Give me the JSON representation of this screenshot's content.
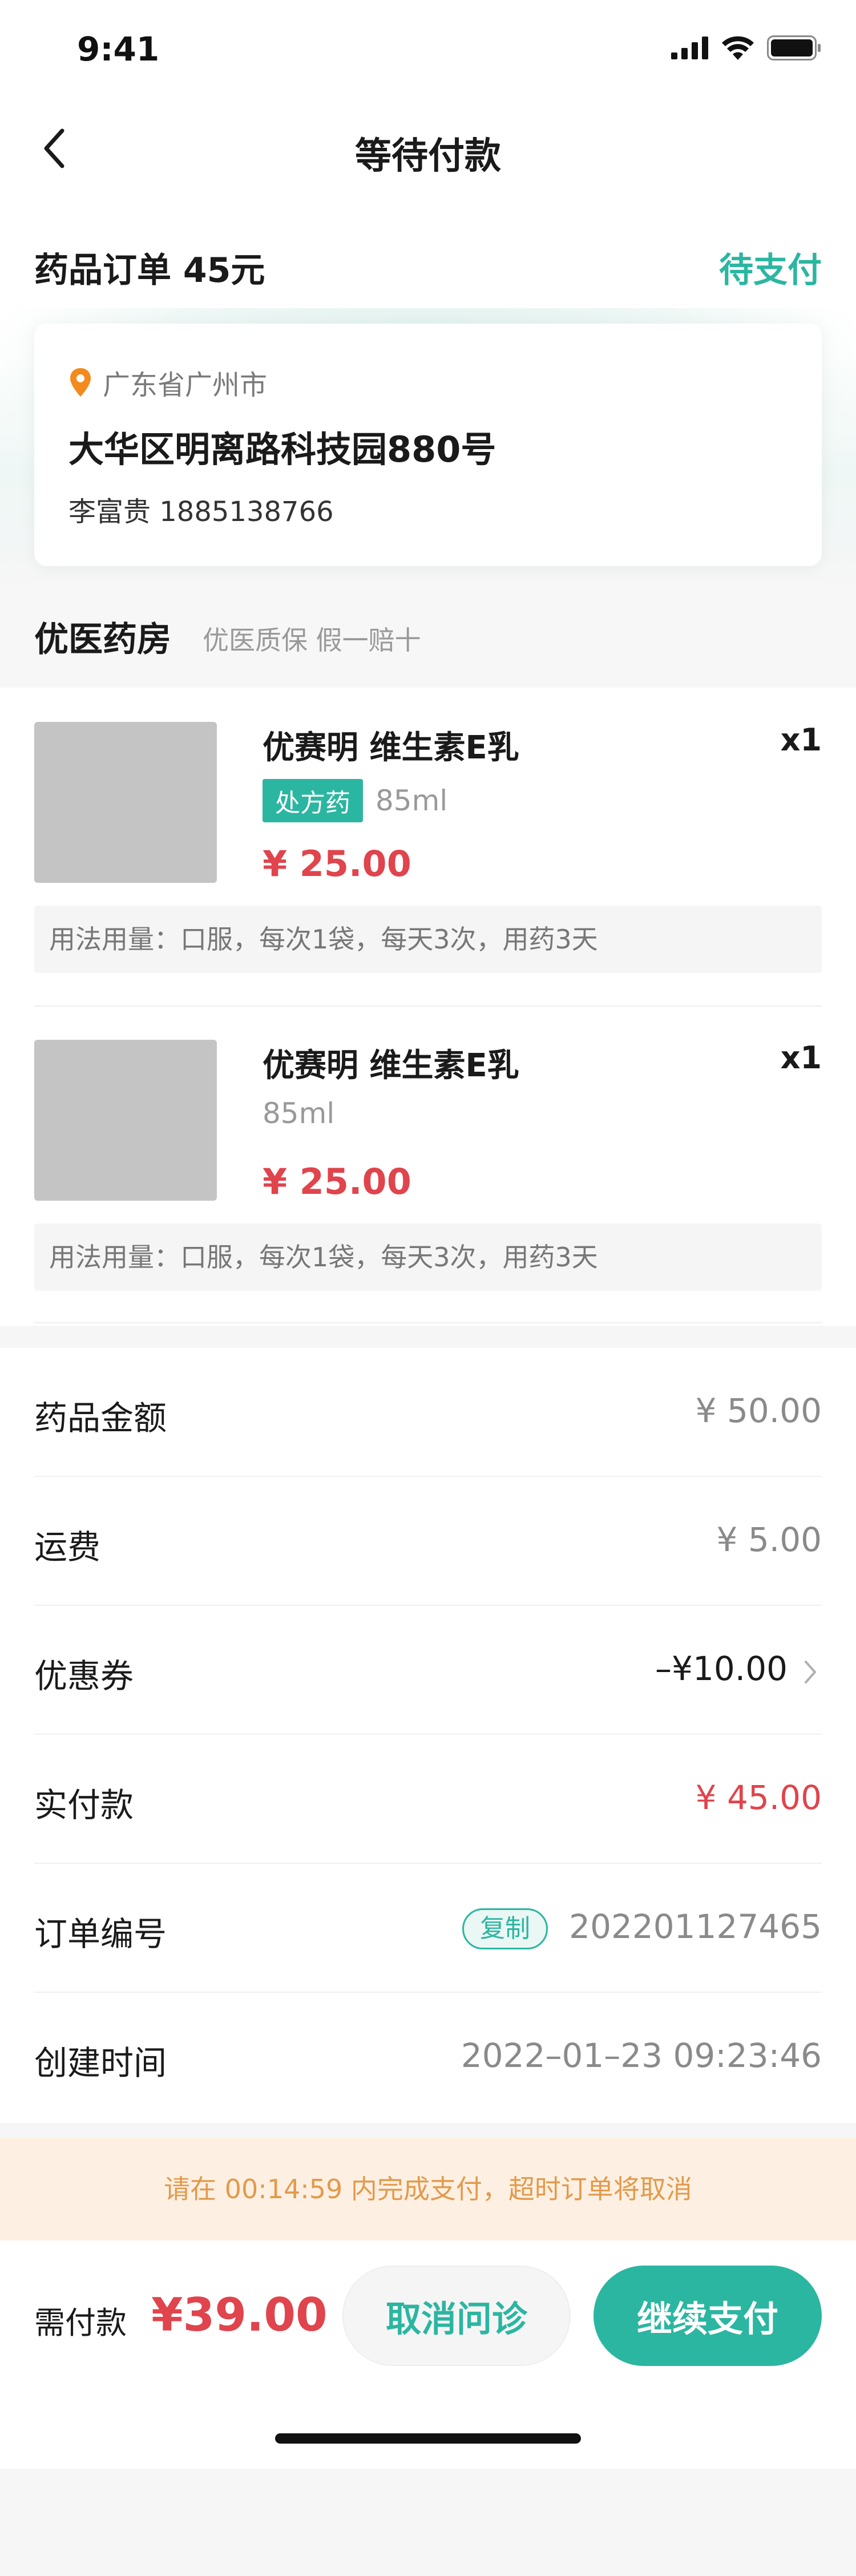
{
  "status_bar": {
    "time": "9:41"
  },
  "nav": {
    "title": "等待付款"
  },
  "order": {
    "title": "药品订单 45元",
    "status": "待支付"
  },
  "address": {
    "region": "广东省广州市",
    "detail": "大华区明离路科技园880号",
    "contact": "李富贵 1885138766"
  },
  "store": {
    "name": "优医药房",
    "tag": "优医质保 假一赔十"
  },
  "items": [
    {
      "name": "优赛明 维生素E乳",
      "qty": "x1",
      "badge": "处方药",
      "spec": "85ml",
      "price": "¥ 25.00",
      "usage": "用法用量：口服，每次1袋，每天3次，用药3天"
    },
    {
      "name": "优赛明 维生素E乳",
      "qty": "x1",
      "spec": "85ml",
      "price": "¥ 25.00",
      "usage": "用法用量：口服，每次1袋，每天3次，用药3天"
    }
  ],
  "summary": {
    "drug_amount_label": "药品金额",
    "drug_amount": "¥ 50.00",
    "shipping_label": "运费",
    "shipping": "¥ 5.00",
    "coupon_label": "优惠券",
    "coupon": "–¥10.00",
    "paid_label": "实付款",
    "paid": "¥ 45.00",
    "order_no_label": "订单编号",
    "copy_label": "复制",
    "order_no": "202201127465",
    "created_label": "创建时间",
    "created": "2022–01–23 09:23:46"
  },
  "timer": {
    "text": "请在 00:14:59 内完成支付，超时订单将取消"
  },
  "footer": {
    "pay_label": "需付款",
    "pay_amount": "¥39.00",
    "cancel_label": "取消问诊",
    "pay_button_label": "继续支付"
  },
  "colors": {
    "accent": "#2bb6a1",
    "price_red": "#e0444c",
    "warning_bg": "#fdf0e2",
    "warning_text": "#e29a4c"
  }
}
